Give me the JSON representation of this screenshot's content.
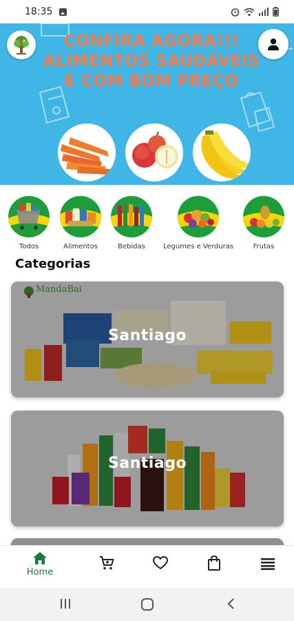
{
  "status_bar": {
    "time": "18:35"
  },
  "banner": {
    "headline": "CONFIRA AGORA!!! ALIMENTOS SAUDÁVEIS E COM BOM PREÇO",
    "images": [
      "carrots",
      "apples",
      "bananas"
    ]
  },
  "categories_strip": {
    "items": [
      {
        "label": "Todos",
        "icon": "shopping-cart-groceries"
      },
      {
        "label": "Alimentos",
        "icon": "food-products"
      },
      {
        "label": "Bebidas",
        "icon": "drinks"
      },
      {
        "label": "Legumes e Verduras",
        "icon": "vegetables"
      },
      {
        "label": "Frutas",
        "icon": "fruits"
      }
    ]
  },
  "section": {
    "title": "Categorias"
  },
  "cards": [
    {
      "title": "Santiago",
      "brand": "MandaBai"
    },
    {
      "title": "Santiago"
    }
  ],
  "bottom_nav": {
    "items": [
      {
        "label": "Home",
        "icon": "home-icon",
        "active": true
      },
      {
        "label": "",
        "icon": "cart-icon"
      },
      {
        "label": "",
        "icon": "heart-icon"
      },
      {
        "label": "",
        "icon": "bag-icon"
      },
      {
        "label": "",
        "icon": "menu-icon"
      }
    ]
  },
  "colors": {
    "banner_bg": "#3fb6e6",
    "headline": "#f47b4e",
    "active_nav": "#1a7a3b",
    "category_green": "#1e9e3a",
    "category_yellow": "#f5d60a"
  }
}
